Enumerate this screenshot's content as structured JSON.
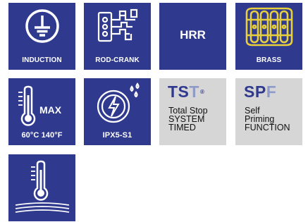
{
  "colors": {
    "navy": "#2f3a8f",
    "grey": "#d6d6d6",
    "brass": "#e8cf3c",
    "light_blue": "#8e9bc9"
  },
  "tiles": [
    {
      "icon": "ground-symbol-icon",
      "caption": "INDUCTION"
    },
    {
      "icon": "rod-crank-mechanism-icon",
      "caption": "ROD-CRANK"
    },
    {
      "label": "HRR"
    },
    {
      "icon": "brass-pipes-icon",
      "caption": "BRASS"
    },
    {
      "icon": "thermometer-icon",
      "label": "MAX",
      "caption": "60°C 140°F"
    },
    {
      "icon": "water-protection-icon",
      "caption": "IPX5-S1"
    },
    {
      "abbr_a": "TS",
      "abbr_b": "T",
      "reg": "®",
      "lines": [
        "Total Stop",
        "SYSTEM",
        "TIMED"
      ]
    },
    {
      "abbr_a": "SP",
      "abbr_b": "F",
      "lines": [
        "Self",
        "Priming",
        "FUNCTION"
      ]
    },
    {
      "icon": "thermometer-waves-icon"
    }
  ]
}
